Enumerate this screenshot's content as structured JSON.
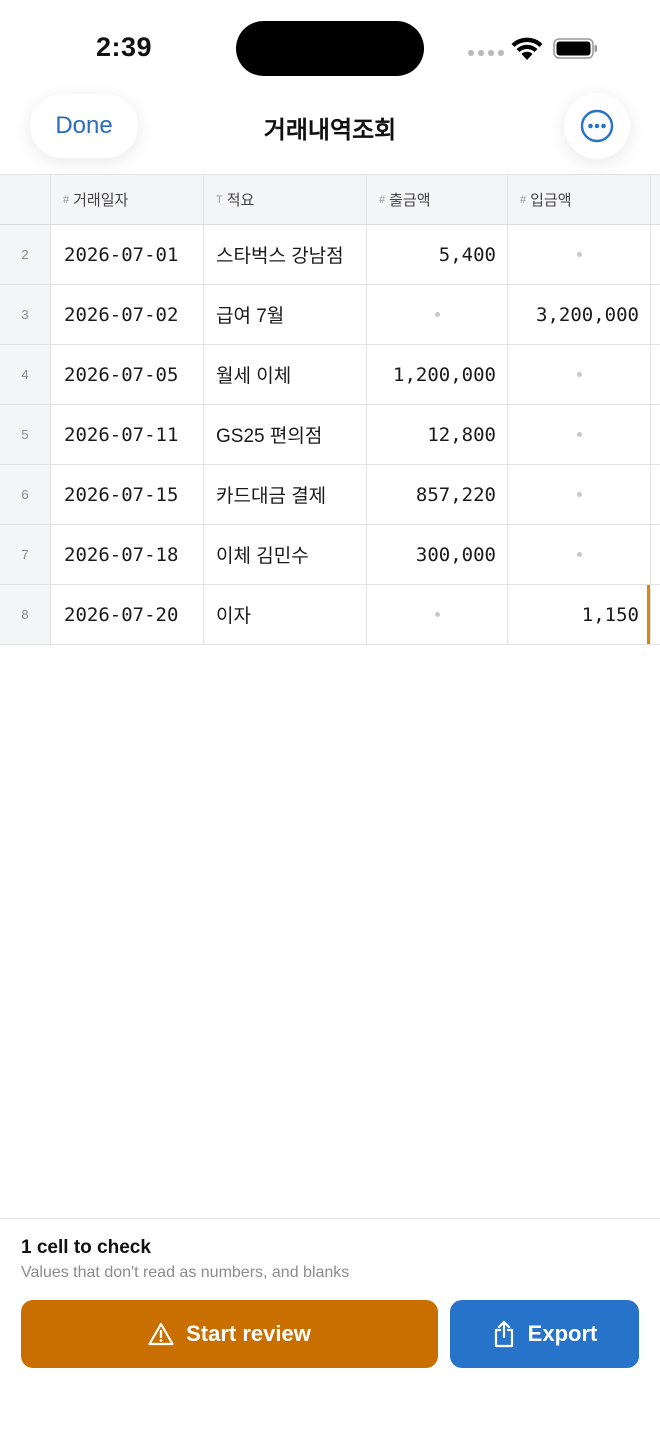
{
  "status_bar": {
    "time": "2:39"
  },
  "nav": {
    "done_label": "Done",
    "title": "거래내역조회",
    "more_icon": "ellipsis-circle-icon"
  },
  "table": {
    "columns": [
      {
        "type_glyph": "#",
        "label": "거래일자"
      },
      {
        "type_glyph": "T",
        "label": "적요"
      },
      {
        "type_glyph": "#",
        "label": "출금액"
      },
      {
        "type_glyph": "#",
        "label": "입금액"
      }
    ],
    "rows": [
      {
        "index": "2",
        "date": "2026-07-01",
        "memo": "스타벅스 강남점",
        "withdrawal": "5,400",
        "deposit": ""
      },
      {
        "index": "3",
        "date": "2026-07-02",
        "memo": "급여 7월",
        "withdrawal": "",
        "deposit": "3,200,000"
      },
      {
        "index": "4",
        "date": "2026-07-05",
        "memo": "월세 이체",
        "withdrawal": "1,200,000",
        "deposit": ""
      },
      {
        "index": "5",
        "date": "2026-07-11",
        "memo": "GS25 편의점",
        "withdrawal": "12,800",
        "deposit": ""
      },
      {
        "index": "6",
        "date": "2026-07-15",
        "memo": "카드대금 결제",
        "withdrawal": "857,220",
        "deposit": ""
      },
      {
        "index": "7",
        "date": "2026-07-18",
        "memo": "이체 김민수",
        "withdrawal": "300,000",
        "deposit": ""
      },
      {
        "index": "8",
        "date": "2026-07-20",
        "memo": "이자",
        "withdrawal": "",
        "deposit": "1,150"
      }
    ]
  },
  "review_panel": {
    "title": "1 cell to check",
    "subtitle": "Values that don't read as numbers, and blanks",
    "review_label": "Start review",
    "export_label": "Export"
  },
  "colors": {
    "accent_blue": "#2773c9",
    "warning_orange": "#c86f00",
    "flag_marker": "#d4870e"
  }
}
